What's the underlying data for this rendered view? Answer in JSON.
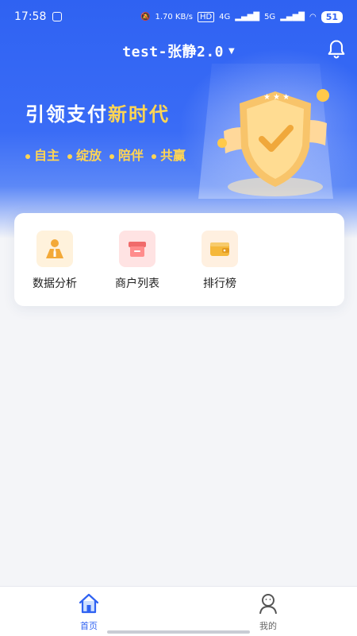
{
  "status_bar": {
    "time": "17:58",
    "net_speed": "1.70 KB/s",
    "hd_label": "HD",
    "net_label": "4G",
    "net_label2": "5G",
    "battery": "51"
  },
  "header": {
    "title": "test-张静2.0"
  },
  "banner": {
    "slogan_main": "引领支付",
    "slogan_accent": "新时代",
    "tags": [
      "自主",
      "绽放",
      "陪伴",
      "共赢"
    ]
  },
  "actions": [
    {
      "label": "数据分析",
      "icon": "data-analysis-icon"
    },
    {
      "label": "商户列表",
      "icon": "merchant-list-icon"
    },
    {
      "label": "排行榜",
      "icon": "ranking-icon"
    }
  ],
  "bottom_nav": [
    {
      "label": "首页",
      "icon": "home-icon",
      "active": true
    },
    {
      "label": "我的",
      "icon": "profile-icon",
      "active": false
    }
  ],
  "colors": {
    "brand_blue": "#2f62f2",
    "accent_yellow": "#ffd553",
    "nav_active": "#2f62f2",
    "nav_inactive": "#666666"
  }
}
